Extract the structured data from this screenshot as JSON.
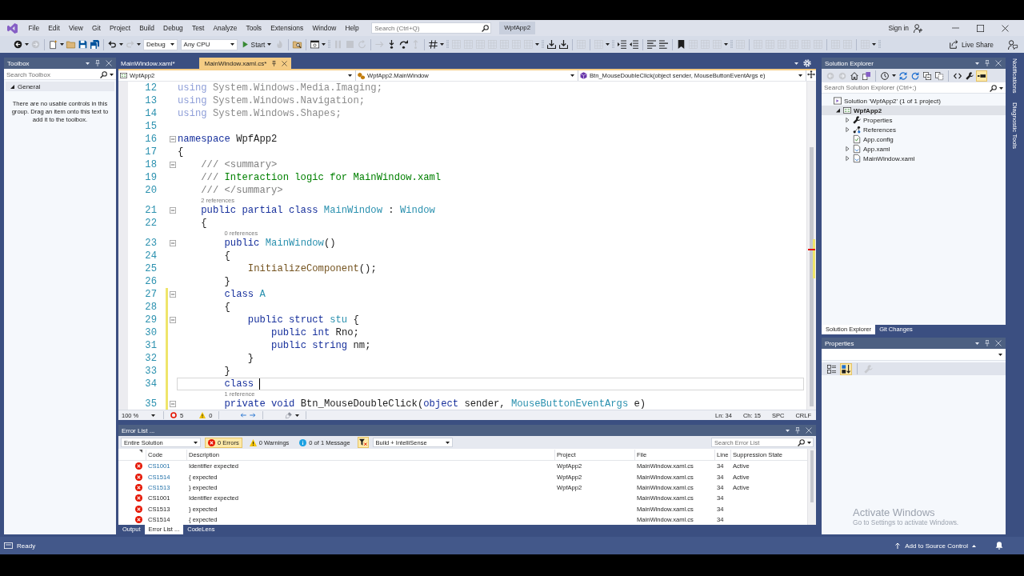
{
  "window": {
    "title": "WpfApp2",
    "account": "Sign in"
  },
  "menu": [
    "File",
    "Edit",
    "View",
    "Git",
    "Project",
    "Build",
    "Debug",
    "Test",
    "Analyze",
    "Tools",
    "Extensions",
    "Window",
    "Help"
  ],
  "search": {
    "placeholder": "Search (Ctrl+Q)"
  },
  "toolbar": [
    {
      "kind": "back",
      "disabled": false
    },
    {
      "kind": "caret"
    },
    {
      "kind": "forward",
      "disabled": true
    },
    {
      "kind": "separator"
    },
    {
      "kind": "new",
      "disabled": false
    },
    {
      "kind": "caret"
    },
    {
      "kind": "open",
      "disabled": false
    },
    {
      "kind": "save",
      "disabled": false
    },
    {
      "kind": "saveall",
      "disabled": false
    },
    {
      "kind": "separator"
    },
    {
      "kind": "undo",
      "disabled": false
    },
    {
      "kind": "caret"
    },
    {
      "kind": "redo",
      "disabled": true
    },
    {
      "kind": "caret"
    },
    {
      "kind": "dropdown",
      "text": "Debug"
    },
    {
      "kind": "dropdown",
      "text": "Any CPU"
    },
    {
      "kind": "start",
      "text": "Start"
    },
    {
      "kind": "flame",
      "disabled": true
    },
    {
      "kind": "separator"
    },
    {
      "kind": "find",
      "disabled": false
    },
    {
      "kind": "separator"
    },
    {
      "kind": "window",
      "disabled": false
    },
    {
      "kind": "caret"
    },
    {
      "kind": "grip"
    },
    {
      "kind": "pause",
      "disabled": true
    },
    {
      "kind": "stop",
      "disabled": true
    },
    {
      "kind": "restart",
      "disabled": true
    },
    {
      "kind": "separator"
    },
    {
      "kind": "arrow",
      "disabled": true
    },
    {
      "kind": "stepinto",
      "disabled": false
    },
    {
      "kind": "stepover",
      "disabled": false
    },
    {
      "kind": "stepout",
      "disabled": true
    },
    {
      "kind": "separator"
    },
    {
      "kind": "hash",
      "disabled": false
    },
    {
      "kind": "caret"
    },
    {
      "kind": "grip"
    },
    {
      "kind": "tool",
      "disabled": true
    },
    {
      "kind": "tool",
      "disabled": true
    },
    {
      "kind": "tool",
      "disabled": true
    },
    {
      "kind": "tool",
      "disabled": true
    },
    {
      "kind": "tool",
      "disabled": true
    },
    {
      "kind": "tool",
      "disabled": true
    },
    {
      "kind": "tool",
      "disabled": true
    },
    {
      "kind": "caret"
    },
    {
      "kind": "grip"
    },
    {
      "kind": "download",
      "disabled": false
    },
    {
      "kind": "download",
      "disabled": false
    },
    {
      "kind": "separator"
    },
    {
      "kind": "tool",
      "disabled": true
    },
    {
      "kind": "separator"
    },
    {
      "kind": "tool",
      "disabled": true
    },
    {
      "kind": "caret"
    },
    {
      "kind": "grip"
    },
    {
      "kind": "indent",
      "disabled": false
    },
    {
      "kind": "outdent",
      "disabled": false
    },
    {
      "kind": "separator"
    },
    {
      "kind": "comment",
      "disabled": false
    },
    {
      "kind": "uncomment",
      "disabled": false
    },
    {
      "kind": "separator"
    },
    {
      "kind": "bookmark",
      "disabled": false
    },
    {
      "kind": "tool",
      "disabled": true
    },
    {
      "kind": "tool",
      "disabled": true
    },
    {
      "kind": "tool",
      "disabled": true
    },
    {
      "kind": "caret"
    },
    {
      "kind": "grip"
    },
    {
      "kind": "tool",
      "disabled": true
    },
    {
      "kind": "separator"
    },
    {
      "kind": "tool",
      "disabled": true
    },
    {
      "kind": "tool",
      "disabled": true
    },
    {
      "kind": "tool",
      "disabled": true
    },
    {
      "kind": "tool",
      "disabled": true
    },
    {
      "kind": "tool",
      "disabled": true
    },
    {
      "kind": "tool",
      "disabled": true
    },
    {
      "kind": "separator"
    },
    {
      "kind": "tool",
      "disabled": true
    },
    {
      "kind": "tool",
      "disabled": true
    },
    {
      "kind": "separator"
    },
    {
      "kind": "tool",
      "disabled": true
    },
    {
      "kind": "caret"
    },
    {
      "kind": "grip"
    }
  ],
  "live_share": {
    "label": "Live Share"
  },
  "toolbox": {
    "title": "Toolbox",
    "search": {
      "placeholder": "Search Toolbox"
    },
    "groups": [
      {
        "label": "General",
        "expanded": true,
        "message": "There are no usable controls in this group. Drag an item onto this text to add it to the toolbox."
      }
    ]
  },
  "editor": {
    "tabs": [
      {
        "label": "MainWindow.xaml*",
        "selected": false
      },
      {
        "label": "MainWindow.xaml.cs*",
        "selected": true
      }
    ],
    "navigation": [
      {
        "kind": "project",
        "text": "WpfApp2"
      },
      {
        "kind": "class",
        "text": "WpfApp2.MainWindow"
      },
      {
        "kind": "method",
        "text": "Btn_MouseDoubleClick(object sender, MouseButtonEventArgs e)"
      }
    ],
    "lines": [
      {
        "number": "12",
        "fold": false,
        "changed": false,
        "current": false,
        "tokens": [
          {
            "kind": "unused-keyword",
            "text": "using"
          },
          {
            "kind": "unused",
            "text": " System.Windows.Media.Imaging;"
          }
        ]
      },
      {
        "number": "13",
        "fold": false,
        "changed": false,
        "current": false,
        "tokens": [
          {
            "kind": "unused-keyword",
            "text": "using"
          },
          {
            "kind": "unused",
            "text": " System.Windows.Navigation;"
          }
        ]
      },
      {
        "number": "14",
        "fold": false,
        "changed": false,
        "current": false,
        "tokens": [
          {
            "kind": "unused-keyword",
            "text": "using"
          },
          {
            "kind": "unused",
            "text": " System.Windows.Shapes;"
          }
        ]
      },
      {
        "number": "15",
        "fold": false,
        "changed": false,
        "current": false
      },
      {
        "number": "16",
        "fold": true,
        "changed": false,
        "current": false,
        "tokens": [
          {
            "kind": "keyword",
            "text": "namespace"
          },
          {
            "kind": "plain",
            "text": " WpfApp2"
          }
        ]
      },
      {
        "number": "17",
        "fold": false,
        "changed": false,
        "current": false,
        "tokens": [
          {
            "kind": "plain",
            "text": "{"
          }
        ]
      },
      {
        "number": "18",
        "fold": true,
        "changed": false,
        "current": false,
        "tokens": [
          {
            "kind": "doc",
            "text": "    /// <summary>"
          }
        ]
      },
      {
        "number": "19",
        "fold": false,
        "changed": false,
        "current": false,
        "tokens": [
          {
            "kind": "doc",
            "text": "    ///"
          },
          {
            "kind": "comment",
            "text": " Interaction logic for MainWindow.xaml"
          }
        ]
      },
      {
        "number": "20",
        "fold": false,
        "changed": false,
        "current": false,
        "tokens": [
          {
            "kind": "doc",
            "text": "    /// </summary>"
          }
        ]
      },
      {
        "number": "21",
        "lens": "2 references",
        "fold": true,
        "changed": false,
        "current": false,
        "tokens": [
          {
            "kind": "keyword",
            "text": "    public partial class "
          },
          {
            "kind": "type",
            "text": "MainWindow"
          },
          {
            "kind": "plain",
            "text": " : "
          },
          {
            "kind": "type",
            "text": "Window"
          }
        ]
      },
      {
        "number": "22",
        "fold": false,
        "changed": false,
        "current": false,
        "tokens": [
          {
            "kind": "plain",
            "text": "    {"
          }
        ]
      },
      {
        "number": "23",
        "lens": "0 references",
        "fold": true,
        "changed": false,
        "current": false,
        "tokens": [
          {
            "kind": "keyword",
            "text": "        public "
          },
          {
            "kind": "type",
            "text": "MainWindow"
          },
          {
            "kind": "plain",
            "text": "()"
          }
        ]
      },
      {
        "number": "24",
        "fold": false,
        "changed": false,
        "current": false,
        "tokens": [
          {
            "kind": "plain",
            "text": "        {"
          }
        ]
      },
      {
        "number": "25",
        "fold": false,
        "changed": false,
        "current": false,
        "tokens": [
          {
            "kind": "method",
            "text": "            InitializeComponent"
          },
          {
            "kind": "plain",
            "text": "();"
          }
        ]
      },
      {
        "number": "26",
        "fold": false,
        "changed": false,
        "current": false,
        "tokens": [
          {
            "kind": "plain",
            "text": "        }"
          }
        ]
      },
      {
        "number": "27",
        "fold": true,
        "changed": true,
        "current": false,
        "tokens": [
          {
            "kind": "keyword",
            "text": "        class "
          },
          {
            "kind": "type",
            "text": "A"
          }
        ]
      },
      {
        "number": "28",
        "fold": false,
        "changed": true,
        "current": false,
        "tokens": [
          {
            "kind": "plain",
            "text": "        {"
          }
        ]
      },
      {
        "number": "29",
        "fold": true,
        "changed": true,
        "current": false,
        "tokens": [
          {
            "kind": "keyword",
            "text": "            public struct "
          },
          {
            "kind": "type",
            "text": "stu"
          },
          {
            "kind": "plain",
            "text": " {"
          }
        ]
      },
      {
        "number": "30",
        "fold": false,
        "changed": true,
        "current": false,
        "tokens": [
          {
            "kind": "keyword",
            "text": "                public int"
          },
          {
            "kind": "plain",
            "text": " Rno;"
          }
        ]
      },
      {
        "number": "31",
        "fold": false,
        "changed": true,
        "current": false,
        "tokens": [
          {
            "kind": "keyword",
            "text": "                public string"
          },
          {
            "kind": "plain",
            "text": " nm;"
          }
        ]
      },
      {
        "number": "32",
        "fold": false,
        "changed": true,
        "current": false,
        "tokens": [
          {
            "kind": "plain",
            "text": "            }"
          }
        ]
      },
      {
        "number": "33",
        "fold": false,
        "changed": true,
        "current": false,
        "tokens": [
          {
            "kind": "plain",
            "text": "        }"
          }
        ]
      },
      {
        "number": "34",
        "fold": false,
        "changed": true,
        "current": true,
        "tokens": [
          {
            "kind": "keyword",
            "text": "        class "
          }
        ]
      },
      {
        "number": "35",
        "lens": "1 reference",
        "fold": true,
        "changed": true,
        "current": false,
        "tokens": [
          {
            "kind": "keyword",
            "text": "        private void"
          },
          {
            "kind": "plain",
            "text": " Btn_MouseDoubleClick("
          },
          {
            "kind": "keyword",
            "text": "object"
          },
          {
            "kind": "plain",
            "text": " sender, "
          },
          {
            "kind": "type",
            "text": "MouseButtonEventArgs"
          },
          {
            "kind": "plain",
            "text": " e)"
          }
        ]
      }
    ],
    "zoom": "100 %",
    "errors": "5",
    "warnings": "0",
    "line_position": "Ln: 34",
    "column_position": "Ch: 15",
    "indentation": "SPC",
    "line_ending": "CRLF"
  },
  "error_list": {
    "title": "Error List ...",
    "scope": "Entire Solution",
    "filters": [
      {
        "kind": "error",
        "label": "0 Errors",
        "selected": true
      },
      {
        "kind": "warning",
        "label": "0 Warnings",
        "selected": false
      },
      {
        "kind": "message",
        "label": "0 of 1 Message",
        "selected": false
      }
    ],
    "filter_toggle": {
      "selected": true
    },
    "source": "Build + IntelliSense",
    "search": {
      "placeholder": "Search Error List"
    },
    "columns": [
      "Code",
      "Description",
      "Project",
      "File",
      "Line",
      "Suppression State"
    ],
    "rows": [
      {
        "code": "CS1001",
        "linked": true,
        "description": "Identifier expected",
        "project": "WpfApp2",
        "file": "MainWindow.xaml.cs",
        "line": "34",
        "suppression": "Active"
      },
      {
        "code": "CS1514",
        "linked": true,
        "description": "{ expected",
        "project": "WpfApp2",
        "file": "MainWindow.xaml.cs",
        "line": "34",
        "suppression": "Active"
      },
      {
        "code": "CS1513",
        "linked": true,
        "description": "} expected",
        "project": "WpfApp2",
        "file": "MainWindow.xaml.cs",
        "line": "34",
        "suppression": "Active"
      },
      {
        "code": "CS1001",
        "linked": false,
        "description": "Identifier expected",
        "file": "MainWindow.xaml.cs",
        "line": "34"
      },
      {
        "code": "CS1513",
        "linked": false,
        "description": "} expected",
        "file": "MainWindow.xaml.cs",
        "line": "34"
      },
      {
        "code": "CS1514",
        "linked": false,
        "description": "{ expected",
        "file": "MainWindow.xaml.cs",
        "line": "34"
      }
    ],
    "tabs": [
      {
        "label": "Output",
        "selected": false
      },
      {
        "label": "Error List ...",
        "selected": true
      },
      {
        "label": "CodeLens",
        "selected": false
      }
    ]
  },
  "solution_explorer": {
    "title": "Solution Explorer",
    "toolbar": [
      {
        "kind": "back",
        "disabled": true,
        "selected": false
      },
      {
        "kind": "forward",
        "disabled": true,
        "selected": false
      },
      {
        "kind": "home",
        "disabled": false,
        "selected": false
      },
      {
        "kind": "switch",
        "disabled": false,
        "selected": false
      },
      {
        "kind": "separator"
      },
      {
        "kind": "history",
        "disabled": false,
        "selected": false
      },
      {
        "kind": "caret"
      },
      {
        "kind": "sync",
        "disabled": false,
        "selected": false
      },
      {
        "kind": "refresh",
        "disabled": false,
        "selected": false
      },
      {
        "kind": "collapse",
        "disabled": false,
        "selected": false
      },
      {
        "kind": "files",
        "disabled": false,
        "selected": false
      },
      {
        "kind": "separator"
      },
      {
        "kind": "code",
        "disabled": false,
        "selected": false
      },
      {
        "kind": "wrench",
        "disabled": false,
        "selected": false
      },
      {
        "kind": "preview",
        "disabled": false,
        "selected": true
      }
    ],
    "search": {
      "placeholder": "Search Solution Explorer (Ctrl+;)"
    },
    "tree": [
      {
        "kind": "solution",
        "label": "Solution 'WpfApp2' (1 of 1 project)",
        "selected": false,
        "children": [
          {
            "kind": "project",
            "label": "WpfApp2",
            "expanded": true,
            "selected": true,
            "children": [
              {
                "kind": "properties",
                "label": "Properties",
                "expanded": false,
                "selected": false
              },
              {
                "kind": "references",
                "label": "References",
                "expanded": false,
                "selected": false
              },
              {
                "kind": "config",
                "label": "App.config",
                "selected": false
              },
              {
                "kind": "xaml",
                "label": "App.xaml",
                "expanded": false,
                "selected": false
              },
              {
                "kind": "xaml",
                "label": "MainWindow.xaml",
                "expanded": false,
                "selected": false
              }
            ]
          }
        ]
      }
    ],
    "tabs": [
      {
        "label": "Solution Explorer",
        "selected": true
      },
      {
        "label": "Git Changes",
        "selected": false
      }
    ]
  },
  "properties": {
    "title": "Properties",
    "toolbar": [
      {
        "kind": "categorized",
        "disabled": false,
        "selected": false
      },
      {
        "kind": "alphabetical",
        "disabled": false,
        "selected": true
      },
      {
        "kind": "separator"
      },
      {
        "kind": "wrench",
        "disabled": true,
        "selected": false
      }
    ]
  },
  "side_tabs": [
    "Notifications",
    "Diagnostic Tools"
  ],
  "activation": {
    "title": "Activate Windows",
    "text": "Go to Settings to activate Windows."
  },
  "status_bar": {
    "text": "Ready",
    "source_control": "Add to Source Control"
  }
}
